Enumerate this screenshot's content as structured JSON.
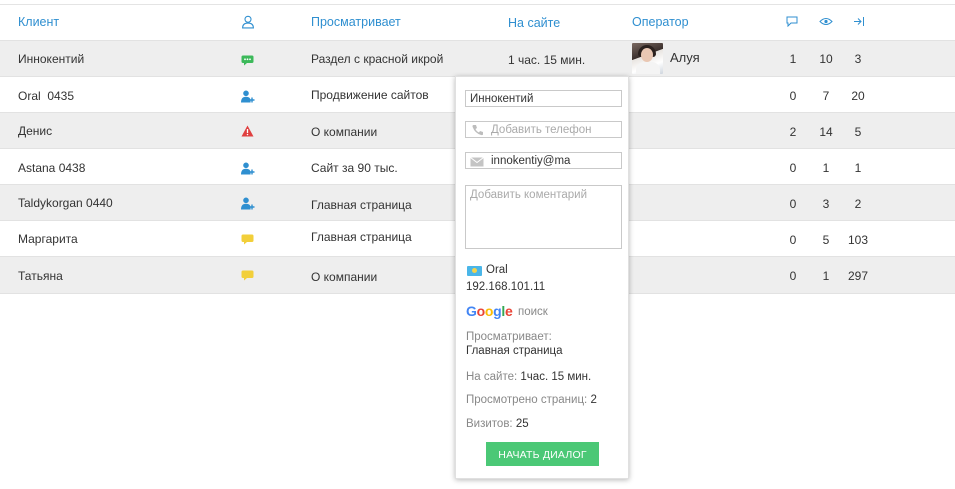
{
  "header": {
    "client": "Клиент",
    "viewing": "Просматривает",
    "on_site": "На сайте",
    "operator": "Оператор",
    "user_icon": "user-icon",
    "messages_icon": "chat-bubble-icon",
    "views_icon": "eye-icon",
    "visits_icon": "enter-arrow-icon"
  },
  "rows": [
    {
      "client": "Иннокентий",
      "status_icon": "chat-green-icon",
      "viewing": "Раздел с красной икрой",
      "on_site": "1 час. 15 мин.",
      "operator": "Алуя",
      "messages": "1",
      "views": "10",
      "visits": "3"
    },
    {
      "client": "Oral  0435",
      "status_icon": "user-add-icon",
      "viewing": "Продвижение сайтов",
      "on_site": "",
      "operator": "",
      "messages": "0",
      "views": "7",
      "visits": "20"
    },
    {
      "client": "Денис",
      "status_icon": "warning-icon",
      "viewing": "О компании",
      "on_site": "",
      "operator": "",
      "messages": "2",
      "views": "14",
      "visits": "5"
    },
    {
      "client": "Astana 0438",
      "status_icon": "user-add-icon",
      "viewing": "Сайт за 90 тыс.",
      "on_site": "",
      "operator": "",
      "messages": "0",
      "views": "1",
      "visits": "1"
    },
    {
      "client": "Taldykorgan 0440",
      "status_icon": "user-add-icon",
      "viewing": "Главная страница",
      "on_site": "",
      "operator": "",
      "messages": "0",
      "views": "3",
      "visits": "2"
    },
    {
      "client": "Маргарита",
      "status_icon": "chat-yellow-icon",
      "viewing": "Главная страница",
      "on_site": "",
      "operator": "",
      "messages": "0",
      "views": "5",
      "visits": "103"
    },
    {
      "client": "Татьяна",
      "status_icon": "chat-yellow-icon",
      "viewing": "О компании",
      "on_site": "",
      "operator": "",
      "messages": "0",
      "views": "1",
      "visits": "297"
    }
  ],
  "popup": {
    "name_value": "Иннокентий",
    "phone_placeholder": "Добавить телефон",
    "email_value": "innokentiy@ma",
    "comment_placeholder": "Добавить коментарий",
    "city": "Oral",
    "ip": "192.168.101.11",
    "search_engine": "Google",
    "search_label": "поиск",
    "viewing_label": "Просматривает:",
    "viewing_value": "Главная страница",
    "on_site_label": "На сайте:",
    "on_site_value": "1час. 15 мин.",
    "pages_label": "Просмотрено страниц:",
    "pages_value": "2",
    "visits_label": "Визитов:",
    "visits_value": "25",
    "start_button": "НАЧАТЬ ДИАЛОГ"
  },
  "colors": {
    "link_blue": "#2f8fd0",
    "row_shade": "#eeeeee",
    "green_button": "#4bc876",
    "status_green": "#3cb95a",
    "status_red": "#e04040",
    "status_yellow": "#f2cf3a"
  }
}
